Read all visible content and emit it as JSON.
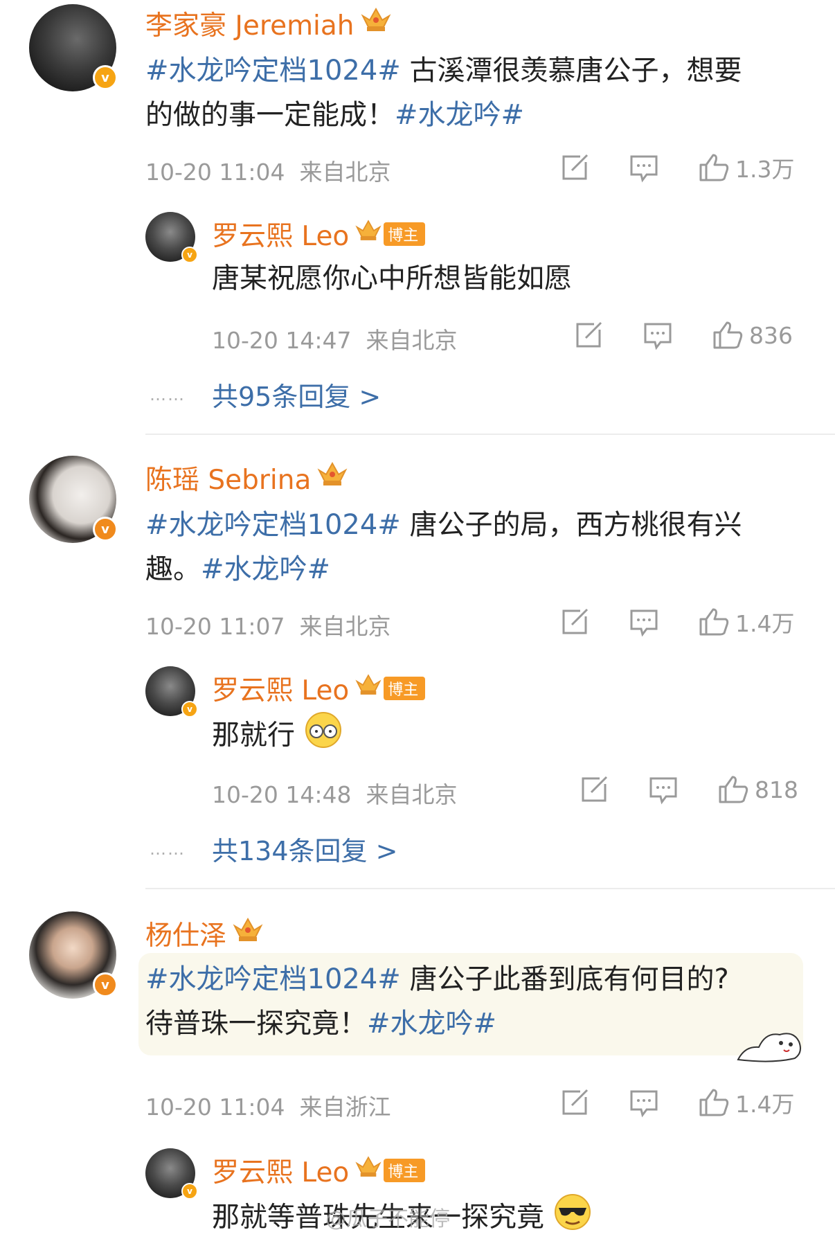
{
  "comments": [
    {
      "username": "李家豪 Jeremiah",
      "topic_prefix": "#水龙吟定档1024#",
      "text_line1": " 古溪潭很羡慕唐公子，想要",
      "text_line2_plain": "的做的事一定能成！",
      "topic_suffix": "#水龙吟#",
      "time": "10-20 11:04",
      "location": "来自北京",
      "likes": "1.3万",
      "reply": {
        "username": "罗云熙 Leo",
        "badge": "博主",
        "text": "唐某祝愿你心中所想皆能如愿",
        "time": "10-20 14:47",
        "location": "来自北京",
        "likes": "836"
      },
      "more_replies": "共95条回复 >"
    },
    {
      "username": "陈瑶 Sebrina",
      "topic_prefix": "#水龙吟定档1024#",
      "text_line1": " 唐公子的局，西方桃很有兴",
      "text_line2_plain": "趣。",
      "topic_suffix": "#水龙吟#",
      "time": "10-20 11:07",
      "location": "来自北京",
      "likes": "1.4万",
      "reply": {
        "username": "罗云熙 Leo",
        "badge": "博主",
        "text": "那就行",
        "time": "10-20 14:48",
        "location": "来自北京",
        "likes": "818"
      },
      "more_replies": "共134条回复 >"
    },
    {
      "username": "杨仕泽",
      "topic_prefix": "#水龙吟定档1024#",
      "text_line1": " 唐公子此番到底有何目的?",
      "text_line2_plain": "待普珠一探究竟！",
      "topic_suffix": "#水龙吟#",
      "time": "10-20 11:04",
      "location": "来自浙江",
      "likes": "1.4万",
      "reply": {
        "username": "罗云熙 Leo",
        "badge": "博主",
        "text": "那就等普珠先生来一探究竟"
      }
    }
  ],
  "dots": "……",
  "watermark": "@瓜子不能停",
  "colors": {
    "username": "#e8731f",
    "topic": "#3d6ea8",
    "meta": "#9a9a9a",
    "badge": "#f79a26"
  }
}
